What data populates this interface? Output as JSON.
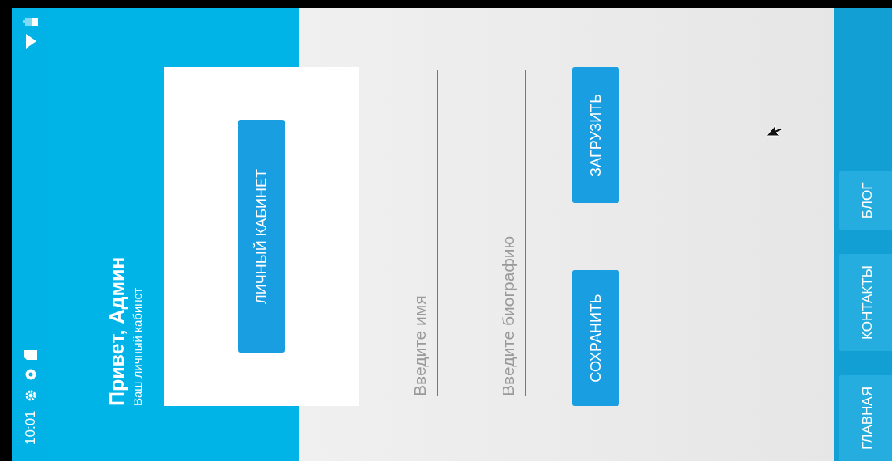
{
  "status_bar": {
    "time": "10:01"
  },
  "header": {
    "title": "Привет, Админ",
    "subtitle": "Ваш личный кабинет"
  },
  "card": {
    "button": "ЛИЧНЫЙ КАБИНЕТ"
  },
  "form": {
    "fields": [
      {
        "placeholder": "Введите имя"
      },
      {
        "placeholder": "Введите биографию"
      }
    ],
    "buttons": [
      "СОХРАНИТЬ",
      "ЗАГРУЗИТЬ"
    ]
  },
  "bottom_nav": [
    {
      "label": "ГЛАВНАЯ"
    },
    {
      "label": "КОНТАКТЫ"
    },
    {
      "label": "БЛОГ"
    }
  ]
}
